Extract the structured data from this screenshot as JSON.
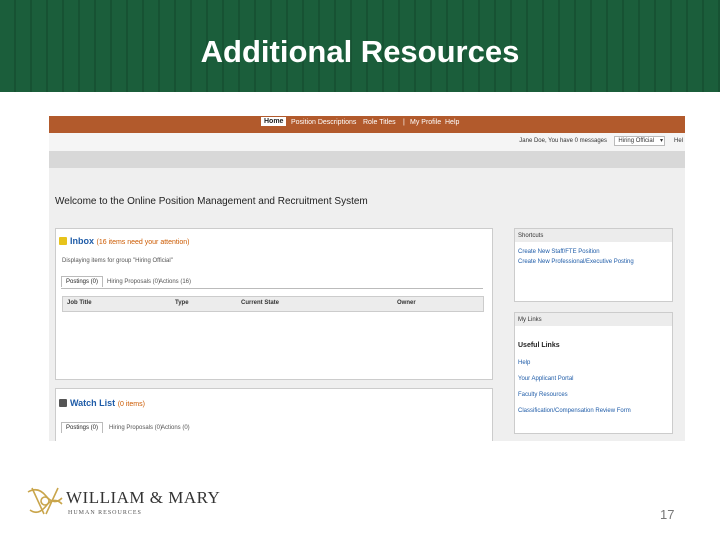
{
  "slide": {
    "title": "Additional Resources",
    "page_number": "17"
  },
  "app": {
    "nav": {
      "items": [
        "Home",
        "Position Descriptions",
        "Role Titles",
        "|",
        "My Profile",
        "Help"
      ],
      "active": "Home"
    },
    "user_bar": {
      "user": "Jane Doe, You have 0 messages",
      "role": "Hiring Official",
      "chevron": "▾",
      "extra": "Hel"
    },
    "welcome_heading": "Welcome to the Online Position Management and Recruitment System",
    "inbox": {
      "title": "Inbox",
      "attention": "(16 items need your attention)",
      "note": "Displaying items for group \"Hiring Official\"",
      "tabs": [
        "Postings (0)",
        "Hiring Proposals (0)",
        "Actions (16)"
      ],
      "columns": [
        "Job Title",
        "Type",
        "Current State",
        "Owner"
      ]
    },
    "watch_list": {
      "title": "Watch List",
      "count": "(0 items)",
      "tabs": [
        "Postings (0)",
        "Hiring Proposals (0)",
        "Actions (0)"
      ]
    },
    "shortcuts": {
      "heading": "Shortcuts",
      "links": [
        "Create New Staff/FTE Position",
        "Create New Professional/Executive Posting"
      ]
    },
    "my_links": {
      "heading": "My Links"
    },
    "useful_links": {
      "heading": "Useful Links",
      "links": [
        "Help",
        "Your Applicant Portal",
        "Faculty Resources",
        "Classification/Compensation Review Form"
      ]
    }
  },
  "brand": {
    "name": "WILLIAM & MARY",
    "sub": "HUMAN RESOURCES",
    "colors": {
      "green": "#1b5e3b",
      "orange": "#b25a2c",
      "gold": "#c9a54b",
      "link_blue": "#1f5ca8"
    }
  }
}
